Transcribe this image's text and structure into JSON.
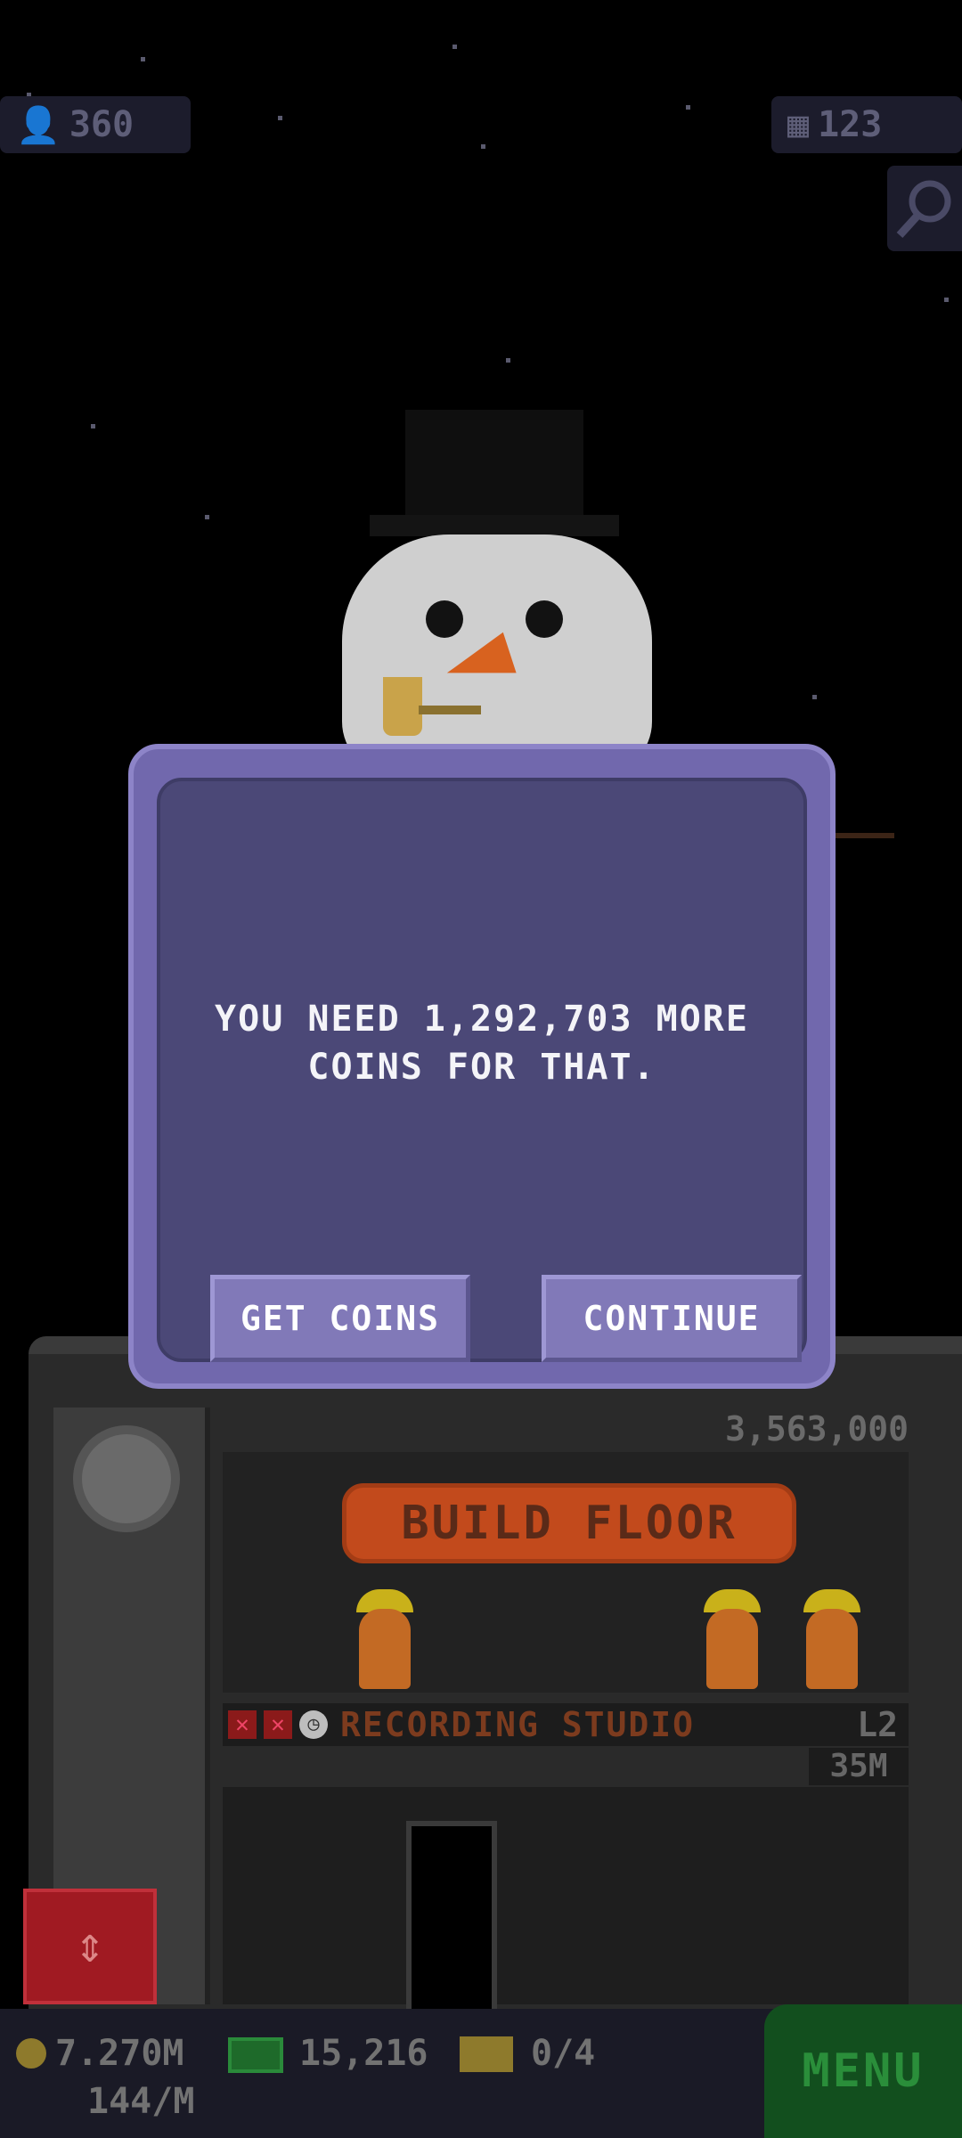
{
  "top": {
    "population": "360",
    "floors": "123"
  },
  "dialog": {
    "message": "YOU NEED 1,292,703 MORE\nCOINS FOR THAT.",
    "get_coins_label": "GET COINS",
    "continue_label": "CONTINUE"
  },
  "tower": {
    "build_price": "3,563,000",
    "build_floor_label": "BUILD FLOOR",
    "studio_name": "RECORDING STUDIO",
    "studio_level": "L2",
    "studio_income": "35M"
  },
  "bottom": {
    "coins": "7.270M",
    "coins_rate": "144/M",
    "bux": "15,216",
    "tickets": "0/4",
    "menu_label": "MENU"
  },
  "icons": [
    "population-icon",
    "floors-icon",
    "search-zoom-icon",
    "coin-icon",
    "bux-icon",
    "ticket-icon",
    "elevator-arrows-icon",
    "closed-x-icon",
    "clock-icon"
  ],
  "colors": {
    "dialog_bg": "#4b4877",
    "dialog_border": "#7168ad",
    "button": "#8179b8",
    "build_sign": "#c24a1c",
    "menu": "#124f1e"
  }
}
